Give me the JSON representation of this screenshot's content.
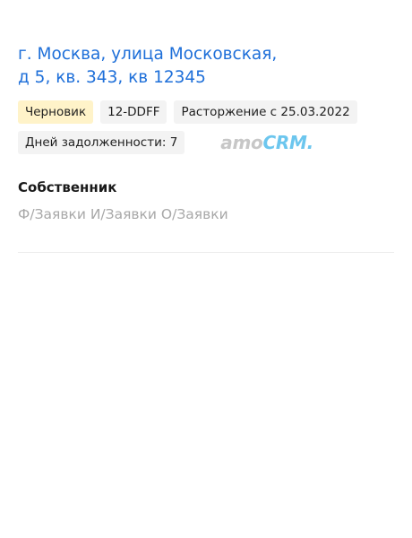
{
  "address": {
    "line": " г. Москва, улица Московская, д 5, кв. 343, кв 12345"
  },
  "tags": {
    "status": "Черновик",
    "code": "12-DDFF",
    "termination": "Расторжение с 25.03.2022",
    "debt_days": "Дней задолженности: 7"
  },
  "crm_logo": {
    "text_amo": "amo",
    "text_crm": "CRM",
    "text_dot": ".",
    "color_amo": "#c7c7c7",
    "color_crm": "#6cc6ee"
  },
  "owner": {
    "title": "Собственник",
    "name": "Ф/Заявки И/Заявки О/Заявки"
  },
  "colors": {
    "link": "#1e6fd9",
    "status_bg": "#fff3c9",
    "tag_bg": "#f3f3f3",
    "muted_text": "#a8a8a8"
  }
}
